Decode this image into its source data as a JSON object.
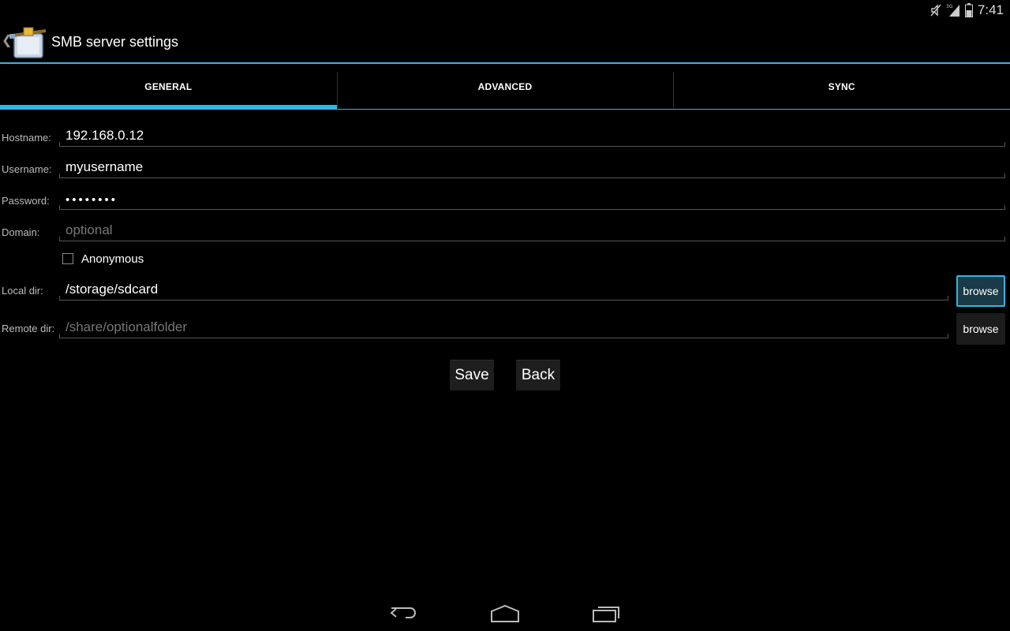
{
  "status_bar": {
    "time": "7:41",
    "icons": [
      "mute-icon",
      "signal-3g-icon",
      "battery-icon"
    ]
  },
  "action_bar": {
    "title": "SMB server settings",
    "app_icon": "network-share-icon"
  },
  "tabs": [
    {
      "label": "GENERAL",
      "active": true
    },
    {
      "label": "ADVANCED",
      "active": false
    },
    {
      "label": "SYNC",
      "active": false
    }
  ],
  "form": {
    "hostname": {
      "label": "Hostname:",
      "value": "192.168.0.12"
    },
    "username": {
      "label": "Username:",
      "value": "myusername"
    },
    "password": {
      "label": "Password:",
      "value": "••••••••"
    },
    "domain": {
      "label": "Domain:",
      "placeholder": "optional"
    },
    "anonymous": {
      "label": "Anonymous",
      "checked": false
    },
    "local_dir": {
      "label": "Local dir:",
      "value": "/storage/sdcard",
      "browse_label": "browse"
    },
    "remote_dir": {
      "label": "Remote dir:",
      "placeholder": "/share/optionalfolder",
      "browse_label": "browse"
    }
  },
  "buttons": {
    "save": "Save",
    "back": "Back"
  },
  "nav_bar": {
    "icons": [
      "back-icon",
      "home-icon",
      "recent-apps-icon"
    ]
  },
  "colors": {
    "accent": "#33b5e5",
    "background": "#000000"
  }
}
